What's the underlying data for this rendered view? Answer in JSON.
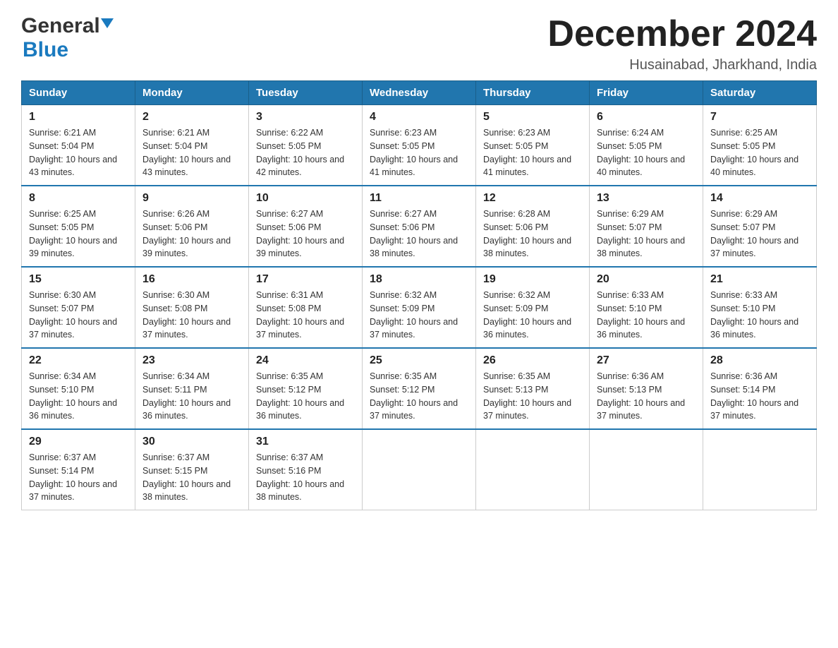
{
  "logo": {
    "general": "General",
    "blue": "Blue"
  },
  "header": {
    "title": "December 2024",
    "location": "Husainabad, Jharkhand, India"
  },
  "days_of_week": [
    "Sunday",
    "Monday",
    "Tuesday",
    "Wednesday",
    "Thursday",
    "Friday",
    "Saturday"
  ],
  "weeks": [
    [
      {
        "day": "1",
        "sunrise": "6:21 AM",
        "sunset": "5:04 PM",
        "daylight": "10 hours and 43 minutes."
      },
      {
        "day": "2",
        "sunrise": "6:21 AM",
        "sunset": "5:04 PM",
        "daylight": "10 hours and 43 minutes."
      },
      {
        "day": "3",
        "sunrise": "6:22 AM",
        "sunset": "5:05 PM",
        "daylight": "10 hours and 42 minutes."
      },
      {
        "day": "4",
        "sunrise": "6:23 AM",
        "sunset": "5:05 PM",
        "daylight": "10 hours and 41 minutes."
      },
      {
        "day": "5",
        "sunrise": "6:23 AM",
        "sunset": "5:05 PM",
        "daylight": "10 hours and 41 minutes."
      },
      {
        "day": "6",
        "sunrise": "6:24 AM",
        "sunset": "5:05 PM",
        "daylight": "10 hours and 40 minutes."
      },
      {
        "day": "7",
        "sunrise": "6:25 AM",
        "sunset": "5:05 PM",
        "daylight": "10 hours and 40 minutes."
      }
    ],
    [
      {
        "day": "8",
        "sunrise": "6:25 AM",
        "sunset": "5:05 PM",
        "daylight": "10 hours and 39 minutes."
      },
      {
        "day": "9",
        "sunrise": "6:26 AM",
        "sunset": "5:06 PM",
        "daylight": "10 hours and 39 minutes."
      },
      {
        "day": "10",
        "sunrise": "6:27 AM",
        "sunset": "5:06 PM",
        "daylight": "10 hours and 39 minutes."
      },
      {
        "day": "11",
        "sunrise": "6:27 AM",
        "sunset": "5:06 PM",
        "daylight": "10 hours and 38 minutes."
      },
      {
        "day": "12",
        "sunrise": "6:28 AM",
        "sunset": "5:06 PM",
        "daylight": "10 hours and 38 minutes."
      },
      {
        "day": "13",
        "sunrise": "6:29 AM",
        "sunset": "5:07 PM",
        "daylight": "10 hours and 38 minutes."
      },
      {
        "day": "14",
        "sunrise": "6:29 AM",
        "sunset": "5:07 PM",
        "daylight": "10 hours and 37 minutes."
      }
    ],
    [
      {
        "day": "15",
        "sunrise": "6:30 AM",
        "sunset": "5:07 PM",
        "daylight": "10 hours and 37 minutes."
      },
      {
        "day": "16",
        "sunrise": "6:30 AM",
        "sunset": "5:08 PM",
        "daylight": "10 hours and 37 minutes."
      },
      {
        "day": "17",
        "sunrise": "6:31 AM",
        "sunset": "5:08 PM",
        "daylight": "10 hours and 37 minutes."
      },
      {
        "day": "18",
        "sunrise": "6:32 AM",
        "sunset": "5:09 PM",
        "daylight": "10 hours and 37 minutes."
      },
      {
        "day": "19",
        "sunrise": "6:32 AM",
        "sunset": "5:09 PM",
        "daylight": "10 hours and 36 minutes."
      },
      {
        "day": "20",
        "sunrise": "6:33 AM",
        "sunset": "5:10 PM",
        "daylight": "10 hours and 36 minutes."
      },
      {
        "day": "21",
        "sunrise": "6:33 AM",
        "sunset": "5:10 PM",
        "daylight": "10 hours and 36 minutes."
      }
    ],
    [
      {
        "day": "22",
        "sunrise": "6:34 AM",
        "sunset": "5:10 PM",
        "daylight": "10 hours and 36 minutes."
      },
      {
        "day": "23",
        "sunrise": "6:34 AM",
        "sunset": "5:11 PM",
        "daylight": "10 hours and 36 minutes."
      },
      {
        "day": "24",
        "sunrise": "6:35 AM",
        "sunset": "5:12 PM",
        "daylight": "10 hours and 36 minutes."
      },
      {
        "day": "25",
        "sunrise": "6:35 AM",
        "sunset": "5:12 PM",
        "daylight": "10 hours and 37 minutes."
      },
      {
        "day": "26",
        "sunrise": "6:35 AM",
        "sunset": "5:13 PM",
        "daylight": "10 hours and 37 minutes."
      },
      {
        "day": "27",
        "sunrise": "6:36 AM",
        "sunset": "5:13 PM",
        "daylight": "10 hours and 37 minutes."
      },
      {
        "day": "28",
        "sunrise": "6:36 AM",
        "sunset": "5:14 PM",
        "daylight": "10 hours and 37 minutes."
      }
    ],
    [
      {
        "day": "29",
        "sunrise": "6:37 AM",
        "sunset": "5:14 PM",
        "daylight": "10 hours and 37 minutes."
      },
      {
        "day": "30",
        "sunrise": "6:37 AM",
        "sunset": "5:15 PM",
        "daylight": "10 hours and 38 minutes."
      },
      {
        "day": "31",
        "sunrise": "6:37 AM",
        "sunset": "5:16 PM",
        "daylight": "10 hours and 38 minutes."
      },
      null,
      null,
      null,
      null
    ]
  ],
  "labels": {
    "sunrise": "Sunrise:",
    "sunset": "Sunset:",
    "daylight": "Daylight:"
  }
}
